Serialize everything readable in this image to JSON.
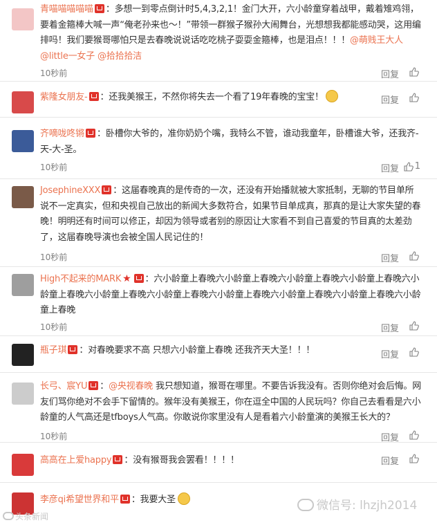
{
  "comments": [
    {
      "user": "青喵喵喵喵喵",
      "segments": [
        {
          "t": "：多想一到零点倒计时5,4,3,2,1！金门大开，六小龄童穿着战甲，戴着雉鸡翎，要着金箍棒大喊一声“俺老孙来也～！”带领一群猴子猴孙大闹舞台，光想想我都能感动哭，这用编排吗！我们要猴哥哪怕只是去春晚说说话吃吃桃子耍耍金箍棒，也是泪点！！！"
        },
        {
          "at": "@萌贱王大人"
        },
        {
          "at": "@little一女子"
        },
        {
          "at": "@拾拾拾洁"
        }
      ],
      "time": "10秒前",
      "reply": "回复",
      "likes": ""
    },
    {
      "user": "紫隆女朋友-",
      "segments": [
        {
          "t": "：还我美猴王，不然你将失去一个看了19年春晚的宝宝！"
        }
      ],
      "time": "10秒前",
      "reply": "回复",
      "likes": ""
    },
    {
      "user": "齐嘀咙咚锵",
      "segments": [
        {
          "t": "：卧槽你大爷的，准你奶奶个嘴，我特么不管，谁动我童年，卧槽谁大爷，还我齐-天-大-圣。"
        }
      ],
      "time": "10秒前",
      "reply": "回复",
      "likes": "1"
    },
    {
      "user": "JosephineXXX",
      "segments": [
        {
          "t": "：这届春晚真的是传奇的一次，还没有开始播就被大家抵制，无聊的节目单所说不一定真实，但和央视自己放出的新闻大多数符合，如果节目单成真，那真的是让大家失望的春晚！明明还有时间可以修正，却因为领导或者别的原因让大家看不到自己喜爱的节目真的太差劲了，这届春晚导演也会被全国人民记住的！"
        }
      ],
      "time": "10秒前",
      "reply": "回复",
      "likes": ""
    },
    {
      "user": "High不起来的MARK",
      "segments": [
        {
          "t": "：六小龄童上春晚六小龄童上春晚六小龄童上春晚六小龄童上春晚六小龄童上春晚六小龄童上春晚六小龄童上春晚六小龄童上春晚六小龄童上春晚六小龄童上春晚六小龄童上春晚"
        }
      ],
      "time": "10秒前",
      "reply": "回复",
      "likes": ""
    },
    {
      "user": "瓶子琪",
      "segments": [
        {
          "t": "：对春晚要求不高  只想六小龄童上春晚   还我齐天大圣！！！"
        }
      ],
      "time": "10秒前",
      "reply": "回复",
      "likes": ""
    },
    {
      "user": "长弓、宸YU",
      "segments": [
        {
          "t": "："
        },
        {
          "at": "@央视春晚"
        },
        {
          "t": " 我只想知道，猴哥在哪里。不要告诉我没有。否则你绝对会后悔。网友们骂你绝对不会手下留情的。猴年没有美猴王，你在逗全中国的人民玩吗？你自己去看看是六小龄童的人气高还是tfboys人气高。你敢说你家里没有人是看着六小龄童演的美猴王长大的？"
        }
      ],
      "time": "10秒前",
      "reply": "回复",
      "likes": ""
    },
    {
      "user": "高高在上爱happy",
      "segments": [
        {
          "t": "：没有猴哥我会罢看！！！！"
        }
      ],
      "time": "10秒前",
      "reply": "回复",
      "likes": ""
    },
    {
      "user": "李彦qi希望世界和平",
      "segments": [
        {
          "t": "：我要大圣"
        }
      ],
      "time": "",
      "reply": "",
      "likes": ""
    }
  ],
  "watermark": "微信号: lhzjh2014",
  "corner_mark": "头条新闻",
  "colors": {
    "username": "#eb7350",
    "meta": "#808080",
    "badge": "#e0322a"
  }
}
